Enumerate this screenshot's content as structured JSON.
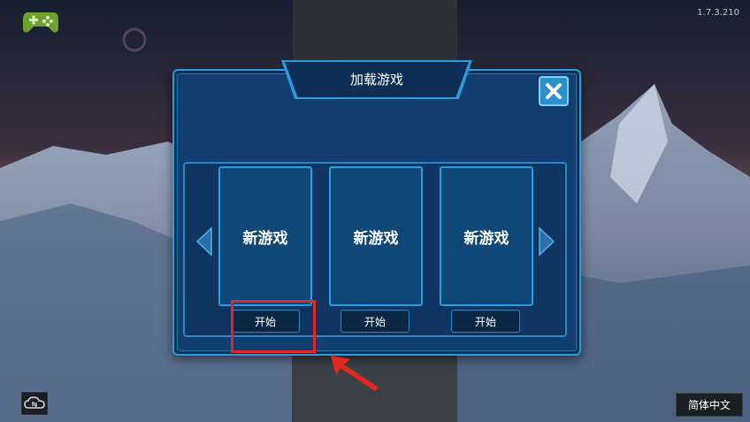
{
  "version": "1.7.3.210",
  "dialog": {
    "title": "加载游戏"
  },
  "slots": [
    {
      "label": "新游戏",
      "button": "开始"
    },
    {
      "label": "新游戏",
      "button": "开始"
    },
    {
      "label": "新游戏",
      "button": "开始"
    }
  ],
  "language_button": "简体中文",
  "icons": {
    "top_left": "gamepad-icon",
    "close": "close-icon",
    "prev": "arrow-left-icon",
    "next": "arrow-right-icon",
    "bottom_left": "cloud-sync-icon"
  },
  "colors": {
    "panel": "#123f6f",
    "border": "#2a9bdc",
    "highlight": "#e3261f"
  }
}
